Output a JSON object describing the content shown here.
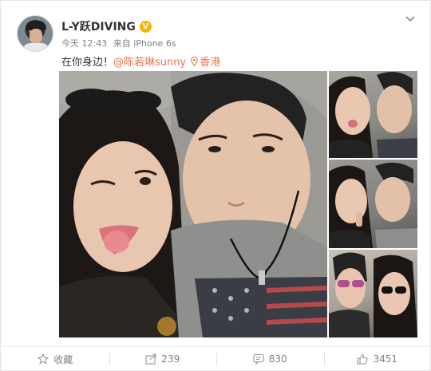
{
  "post": {
    "username": "L-Y跃DIVING",
    "verified_badge": "V",
    "time": "今天 12:43",
    "source": "来自 iPhone 6s",
    "text_prefix": "在你身边！",
    "mention": "@陈若琳sunny",
    "location": "香港"
  },
  "actions": {
    "favorite_label": "收藏",
    "repost_count": "239",
    "comment_count": "830",
    "like_count": "3451"
  },
  "colors": {
    "link": "#eb7350",
    "meta": "#808080",
    "verified": "#f7b500"
  }
}
